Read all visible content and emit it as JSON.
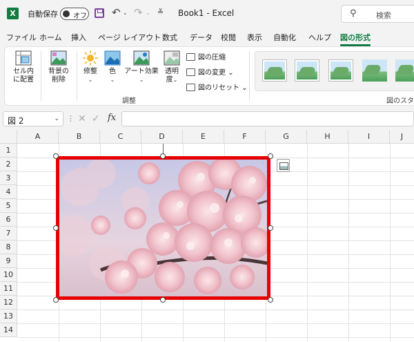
{
  "titlebar": {
    "autosave_label": "自動保存",
    "autosave_state": "オフ",
    "document_title": "Book1 - Excel",
    "search_placeholder": "検索"
  },
  "tabs": [
    "ファイル",
    "ホーム",
    "挿入",
    "ページ レイアウト",
    "数式",
    "データ",
    "校閲",
    "表示",
    "自動化",
    "ヘルプ",
    "図の形式"
  ],
  "active_tab": "図の形式",
  "ribbon": {
    "fit_cell_line1": "セル内",
    "fit_cell_line2": "に配置",
    "remove_bg_line1": "背景の",
    "remove_bg_line2": "削除",
    "corrections": "修整",
    "color": "色",
    "artistic": "アート効果",
    "transparency_line1": "透明",
    "transparency_line2": "度",
    "compress": "図の圧縮",
    "change": "図の変更",
    "reset": "図のリセット",
    "adjust_group": "調整",
    "styles_group": "図のスタイ"
  },
  "formula_bar": {
    "name_box": "図 2",
    "fx": "fx",
    "value": ""
  },
  "columns": [
    "A",
    "B",
    "C",
    "D",
    "E",
    "F",
    "G",
    "H",
    "I",
    "J"
  ],
  "rows": [
    "1",
    "2",
    "3",
    "4",
    "5",
    "6",
    "7",
    "8",
    "9",
    "10",
    "11",
    "12",
    "13",
    "14"
  ],
  "colors": {
    "accent": "#107c41",
    "selection_border": "#e60000"
  }
}
